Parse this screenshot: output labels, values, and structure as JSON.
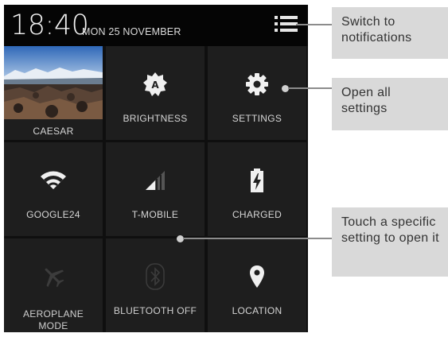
{
  "status_bar": {
    "time": "18:40",
    "date": "MON 25 NOVEMBER",
    "notifications_icon": "notification-list-icon"
  },
  "tiles": [
    {
      "id": "user",
      "label": "CAESAR",
      "icon": "user-photo"
    },
    {
      "id": "brightness",
      "label": "BRIGHTNESS",
      "icon": "brightness-auto-icon"
    },
    {
      "id": "settings",
      "label": "SETTINGS",
      "icon": "gear-icon"
    },
    {
      "id": "wifi",
      "label": "GOOGLE24",
      "icon": "wifi-icon"
    },
    {
      "id": "mobile",
      "label": "T-MOBILE",
      "icon": "signal-icon"
    },
    {
      "id": "battery",
      "label": "CHARGED",
      "icon": "battery-charging-icon"
    },
    {
      "id": "aeroplane",
      "label": "AEROPLANE MODE",
      "icon": "airplane-icon"
    },
    {
      "id": "bluetooth",
      "label": "BLUETOOTH OFF",
      "icon": "bluetooth-icon"
    },
    {
      "id": "location",
      "label": "LOCATION",
      "icon": "location-pin-icon"
    }
  ],
  "callouts": {
    "notifications": "Switch to notifications",
    "settings": "Open all settings",
    "touch": "Touch a specific setting to open it"
  },
  "colors": {
    "panel_bg": "#0f0f0f",
    "tile_bg": "#1e1e1e",
    "text": "#d6d6d6",
    "callout_bg": "#d9d9d9"
  }
}
